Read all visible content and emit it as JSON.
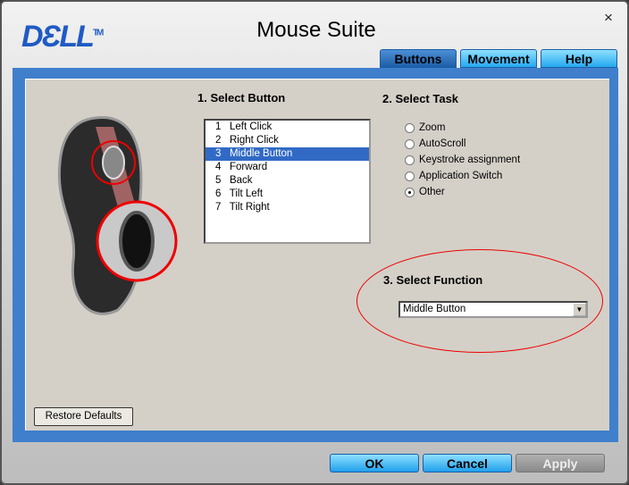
{
  "window": {
    "logo": "DELL",
    "title": "Mouse Suite",
    "close": "×"
  },
  "tabs": [
    {
      "label": "Buttons",
      "active": true
    },
    {
      "label": "Movement"
    },
    {
      "label": "Help"
    }
  ],
  "section1": {
    "heading": "1. Select Button",
    "items": [
      "1   Left Click",
      "2   Right Click",
      "3   Middle Button",
      "4   Forward",
      "5   Back",
      "6   Tilt Left",
      "7   Tilt Right"
    ],
    "selected": "3   Middle Button"
  },
  "section2": {
    "heading": "2. Select Task",
    "options": [
      "Zoom",
      "AutoScroll",
      "Keystroke assignment",
      "Application Switch",
      "Other"
    ],
    "selected": "Other"
  },
  "section3": {
    "heading": "3. Select Function",
    "value": "Middle Button"
  },
  "restore_label": "Restore Defaults",
  "footer": {
    "ok": "OK",
    "cancel": "Cancel",
    "apply": "Apply"
  },
  "colors": {
    "accent": "#3f7fcc",
    "highlight": "#316ac5",
    "annotation": "#e00000"
  }
}
